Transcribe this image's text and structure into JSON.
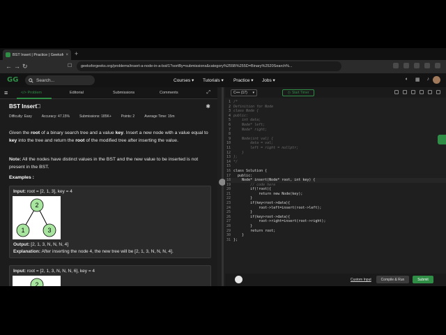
{
  "browser": {
    "tab_title": "BST Insert | Practice | GeeksforGe",
    "tab_close": "×",
    "new_tab": "+",
    "url": "geeksforgeeks.org/problems/insert-a-node-in-a-bst/1?sortBy=submissions&category%255B%255D=Binary%2520Search%..."
  },
  "site": {
    "logo": "GG",
    "search_placeholder": "Search...",
    "menu": [
      "Courses ▾",
      "Tutorials ▾",
      "Practice ▾",
      "Jobs ▾"
    ]
  },
  "problem_tabs": {
    "problem": "</> Problem",
    "editorial": "Editorial",
    "submissions": "Submissions",
    "comments": "Comments"
  },
  "problem": {
    "title": "BST Insert",
    "meta": {
      "difficulty": "Difficulty: Easy",
      "accuracy": "Accuracy: 47.15%",
      "submissions": "Submissions: 185K+",
      "points": "Points: 2",
      "avg_time": "Average Time: 15m"
    },
    "desc_1": "Given the ",
    "desc_root1": "root",
    "desc_2": " of a binary search tree and a value ",
    "desc_key1": "key",
    "desc_3": ". Insert a new node with a value equal to ",
    "desc_key2": "key",
    "desc_4": " into the tree and return the ",
    "desc_root2": "root",
    "desc_5": " of the modified tree after inserting the value.",
    "note_label": "Note:",
    "note_text": " All the nodes have distinct values in the BST and the new value to be inserted is not present in the BST.",
    "examples_label": "Examples :",
    "example1": {
      "input_label": "Input:",
      "input": " root = [2, 1, 3], key = 4",
      "nodes": [
        "2",
        "1",
        "3"
      ],
      "output_label": "Output:",
      "output": " [2, 1, 3, N, N, N, 4]",
      "explanation_label": "Explanation:",
      "explanation": " After inserting the node 4, the new tree will be [2, 1, 3, N, N, N, 4]."
    },
    "example2": {
      "input_label": "Input:",
      "input": " root = [2, 1, 3, N, N, N, 6], key = 4",
      "nodes": [
        "2"
      ]
    }
  },
  "editor": {
    "language": "C++ (17)",
    "start_timer": "Start Timer",
    "lines": [
      {
        "n": "1",
        "t": "/*",
        "c": true
      },
      {
        "n": "2",
        "t": "Definition for Node",
        "c": true
      },
      {
        "n": "3",
        "t": "class Node {",
        "c": true
      },
      {
        "n": "4",
        "t": "public:",
        "c": true
      },
      {
        "n": "5",
        "t": "    int data;",
        "c": true
      },
      {
        "n": "6",
        "t": "    Node* left;",
        "c": true
      },
      {
        "n": "7",
        "t": "    Node* right;",
        "c": true
      },
      {
        "n": "8",
        "t": "",
        "c": true
      },
      {
        "n": "9",
        "t": "    Node(int val) {",
        "c": true
      },
      {
        "n": "10",
        "t": "        data = val;",
        "c": true
      },
      {
        "n": "11",
        "t": "        left = right = nullptr;",
        "c": true
      },
      {
        "n": "12",
        "t": "    }",
        "c": true
      },
      {
        "n": "13",
        "t": "};",
        "c": true
      },
      {
        "n": "14",
        "t": "*/",
        "c": true
      },
      {
        "n": "15",
        "t": "",
        "c": false
      },
      {
        "n": "16",
        "t": "class Solution {",
        "c": false
      },
      {
        "n": "17",
        "t": "  public:",
        "c": false
      },
      {
        "n": "18",
        "t": "    Node* insert(Node* root, int key) {",
        "c": false
      },
      {
        "n": "19",
        "t": "        // code here",
        "c": true
      },
      {
        "n": "20",
        "t": "        if(!root){",
        "c": false
      },
      {
        "n": "21",
        "t": "            return new Node(key);",
        "c": false
      },
      {
        "n": "22",
        "t": "        }",
        "c": false
      },
      {
        "n": "23",
        "t": "        if(key<root->data){",
        "c": false
      },
      {
        "n": "24",
        "t": "            root->left=insert(root->left);",
        "c": false
      },
      {
        "n": "25",
        "t": "        }",
        "c": false
      },
      {
        "n": "26",
        "t": "        if(key>root->data){",
        "c": false
      },
      {
        "n": "27",
        "t": "            root->right=insert(root->right);",
        "c": false
      },
      {
        "n": "28",
        "t": "        }",
        "c": false
      },
      {
        "n": "29",
        "t": "        return root;",
        "c": false
      },
      {
        "n": "30",
        "t": "    }",
        "c": false
      },
      {
        "n": "31",
        "t": "};",
        "c": false
      }
    ],
    "custom_input": "Custom Input",
    "compile_run": "Compile & Run",
    "submit": "Submit"
  },
  "colors": {
    "accent": "#2f8d46"
  }
}
